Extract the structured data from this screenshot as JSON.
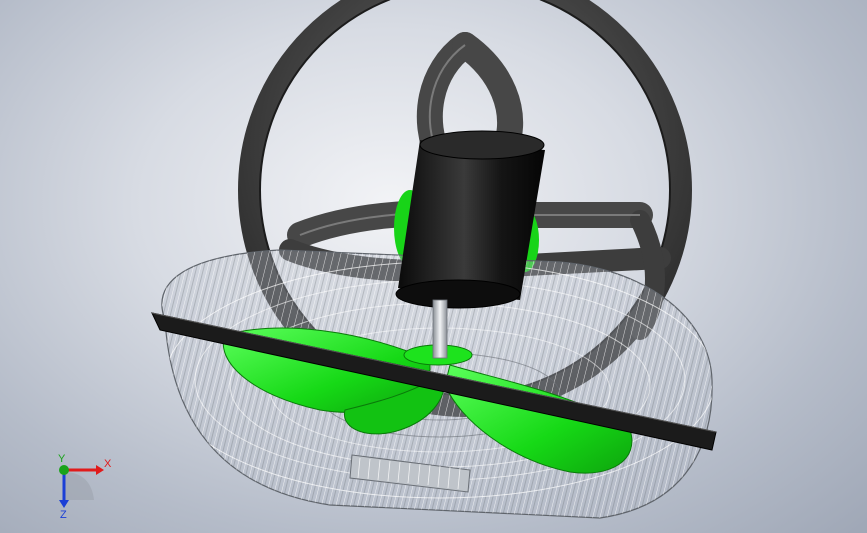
{
  "viewport": {
    "background_color": "#c8ccd6",
    "model_parts": [
      "base-ring",
      "motor-housing",
      "fan-guard",
      "fan-blades",
      "guard-rim",
      "shaft",
      "guard-badge"
    ],
    "colors": {
      "blade": "#19e01a",
      "motor": "#111111",
      "base": "#3a3a3a",
      "guard_wire": "#e8ecef",
      "rim": "#1a1a1a",
      "shaft": "#c9cdd2"
    }
  },
  "triad": {
    "x_label": "X",
    "y_label": "Y",
    "z_label": "Z",
    "x_color": "#e11b1b",
    "y_color": "#1aa31a",
    "z_color": "#1b3fd6"
  }
}
